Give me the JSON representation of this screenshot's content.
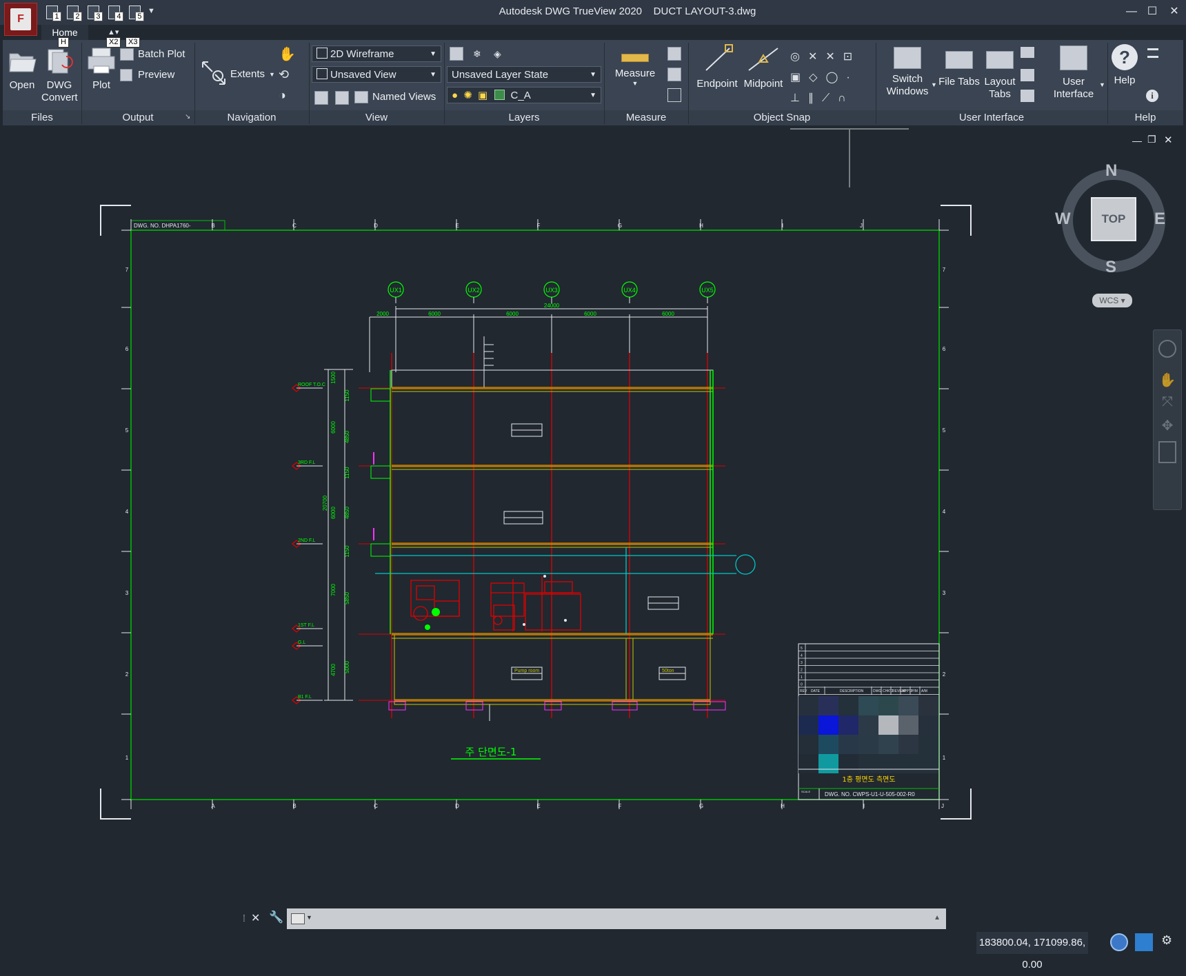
{
  "titlebar": {
    "app_name": "Autodesk DWG TrueView 2020",
    "file_name": "DUCT LAYOUT-3.dwg",
    "quick_access_numbers": [
      "1",
      "2",
      "3",
      "4",
      "5"
    ]
  },
  "app_menu_letter": "F",
  "tabs": [
    {
      "label": "Home",
      "active": true
    }
  ],
  "keytips": {
    "home": "H",
    "x2": "X2",
    "x3": "X3"
  },
  "ribbon": {
    "files": {
      "label": "Files",
      "open": "Open",
      "dwg_convert": "DWG\nConvert"
    },
    "output": {
      "label": "Output",
      "plot": "Plot",
      "batch_plot": "Batch Plot",
      "preview": "Preview"
    },
    "navigation": {
      "label": "Navigation",
      "extents": "Extents"
    },
    "view": {
      "label": "View",
      "visual_style": "2D Wireframe",
      "saved_view": "Unsaved View",
      "named_views": "Named Views"
    },
    "layers": {
      "label": "Layers",
      "layer_state": "Unsaved Layer State",
      "current_layer": "C_A"
    },
    "measure": {
      "label": "Measure",
      "measure": "Measure"
    },
    "object_snap": {
      "label": "Object Snap",
      "endpoint": "Endpoint",
      "midpoint": "Midpoint"
    },
    "user_interface": {
      "label": "User Interface",
      "switch_windows": "Switch\nWindows",
      "file_tabs": "File Tabs",
      "layout_tabs": "Layout\nTabs",
      "user_interface": "User\nInterface"
    },
    "help": {
      "label": "Help",
      "help": "Help"
    }
  },
  "viewcube": {
    "north": "N",
    "south": "S",
    "east": "E",
    "west": "W",
    "face": "TOP",
    "ucs": "WCS"
  },
  "drawing": {
    "grid_labels": [
      "UX1",
      "UX2",
      "UX3",
      "UX4",
      "UX5"
    ],
    "overall_dimension": "24000",
    "bay_dimensions": [
      "2000",
      "6000",
      "6000",
      "6000",
      "6000"
    ],
    "level_labels": [
      "ROOF T.O.C",
      "3RD F.L",
      "2ND F.L",
      "1ST F.L",
      "G.L",
      "B1 F.L"
    ],
    "vertical_dims": [
      "1500",
      "1150",
      "6000",
      "4850",
      "1150",
      "20700",
      "6000",
      "4850",
      "1150",
      "7000",
      "5850",
      "4700",
      "5000"
    ],
    "room_labels": [
      "Pump room",
      "50ton"
    ],
    "section_title": "주 단면도-1",
    "border_top_letters": [
      "B",
      "C",
      "D",
      "E",
      "F",
      "G",
      "H",
      "I",
      "J"
    ],
    "border_bottom_letters": [
      "A",
      "B",
      "C",
      "D",
      "E",
      "F",
      "G",
      "H",
      "I",
      "J"
    ],
    "border_side_numbers": [
      "7",
      "6",
      "5",
      "4",
      "3",
      "2",
      "1"
    ],
    "top_ref": "DWG. NO. DHPA1760-",
    "title_block_title": "1층 평면도 측면도",
    "title_block_dwg_no": "DWG. NO. CWPS-U1-U-505-002-R0",
    "revision_headers": [
      "REV",
      "DATE",
      "DESCRIPTION",
      "DWG",
      "CHK'D",
      "REVIEW",
      "APP'D",
      "P/M",
      "A/M"
    ],
    "revision_rows": [
      "5",
      "4",
      "3",
      "2",
      "1",
      "0"
    ],
    "scale_label": "SCALE"
  },
  "status": {
    "coordinates": "183800.04, 171099.86, 0.00"
  },
  "colors": {
    "background": "#212830",
    "frame": "#00c000",
    "dim": "#00ff00",
    "column": "#e00000",
    "slab": "#c8c800",
    "duct": "#00c8c8"
  }
}
